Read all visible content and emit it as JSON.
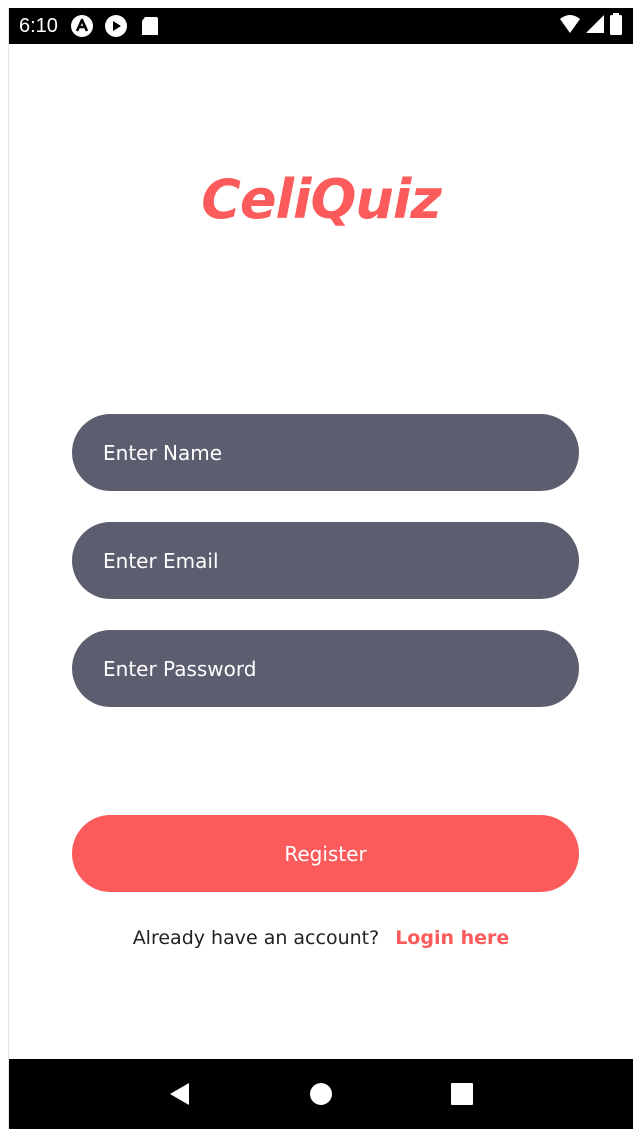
{
  "status_bar": {
    "time": "6:10",
    "icons": [
      "a-circle-icon",
      "play-circle-icon",
      "sd-card-icon"
    ],
    "right_icons": [
      "wifi-icon",
      "signal-icon",
      "battery-icon"
    ]
  },
  "app": {
    "logo_text": "CeliQuiz"
  },
  "form": {
    "name_placeholder": "Enter Name",
    "email_placeholder": "Enter Email",
    "password_placeholder": "Enter Password",
    "register_label": "Register"
  },
  "footer": {
    "prompt": "Already have an account?",
    "login_link": "Login here"
  },
  "nav_bar": {
    "buttons": [
      "back-icon",
      "home-icon",
      "recents-icon"
    ]
  },
  "colors": {
    "accent": "#fb5b5a",
    "input_bg": "#5c5e70",
    "text_on_dark": "#ffffff"
  }
}
